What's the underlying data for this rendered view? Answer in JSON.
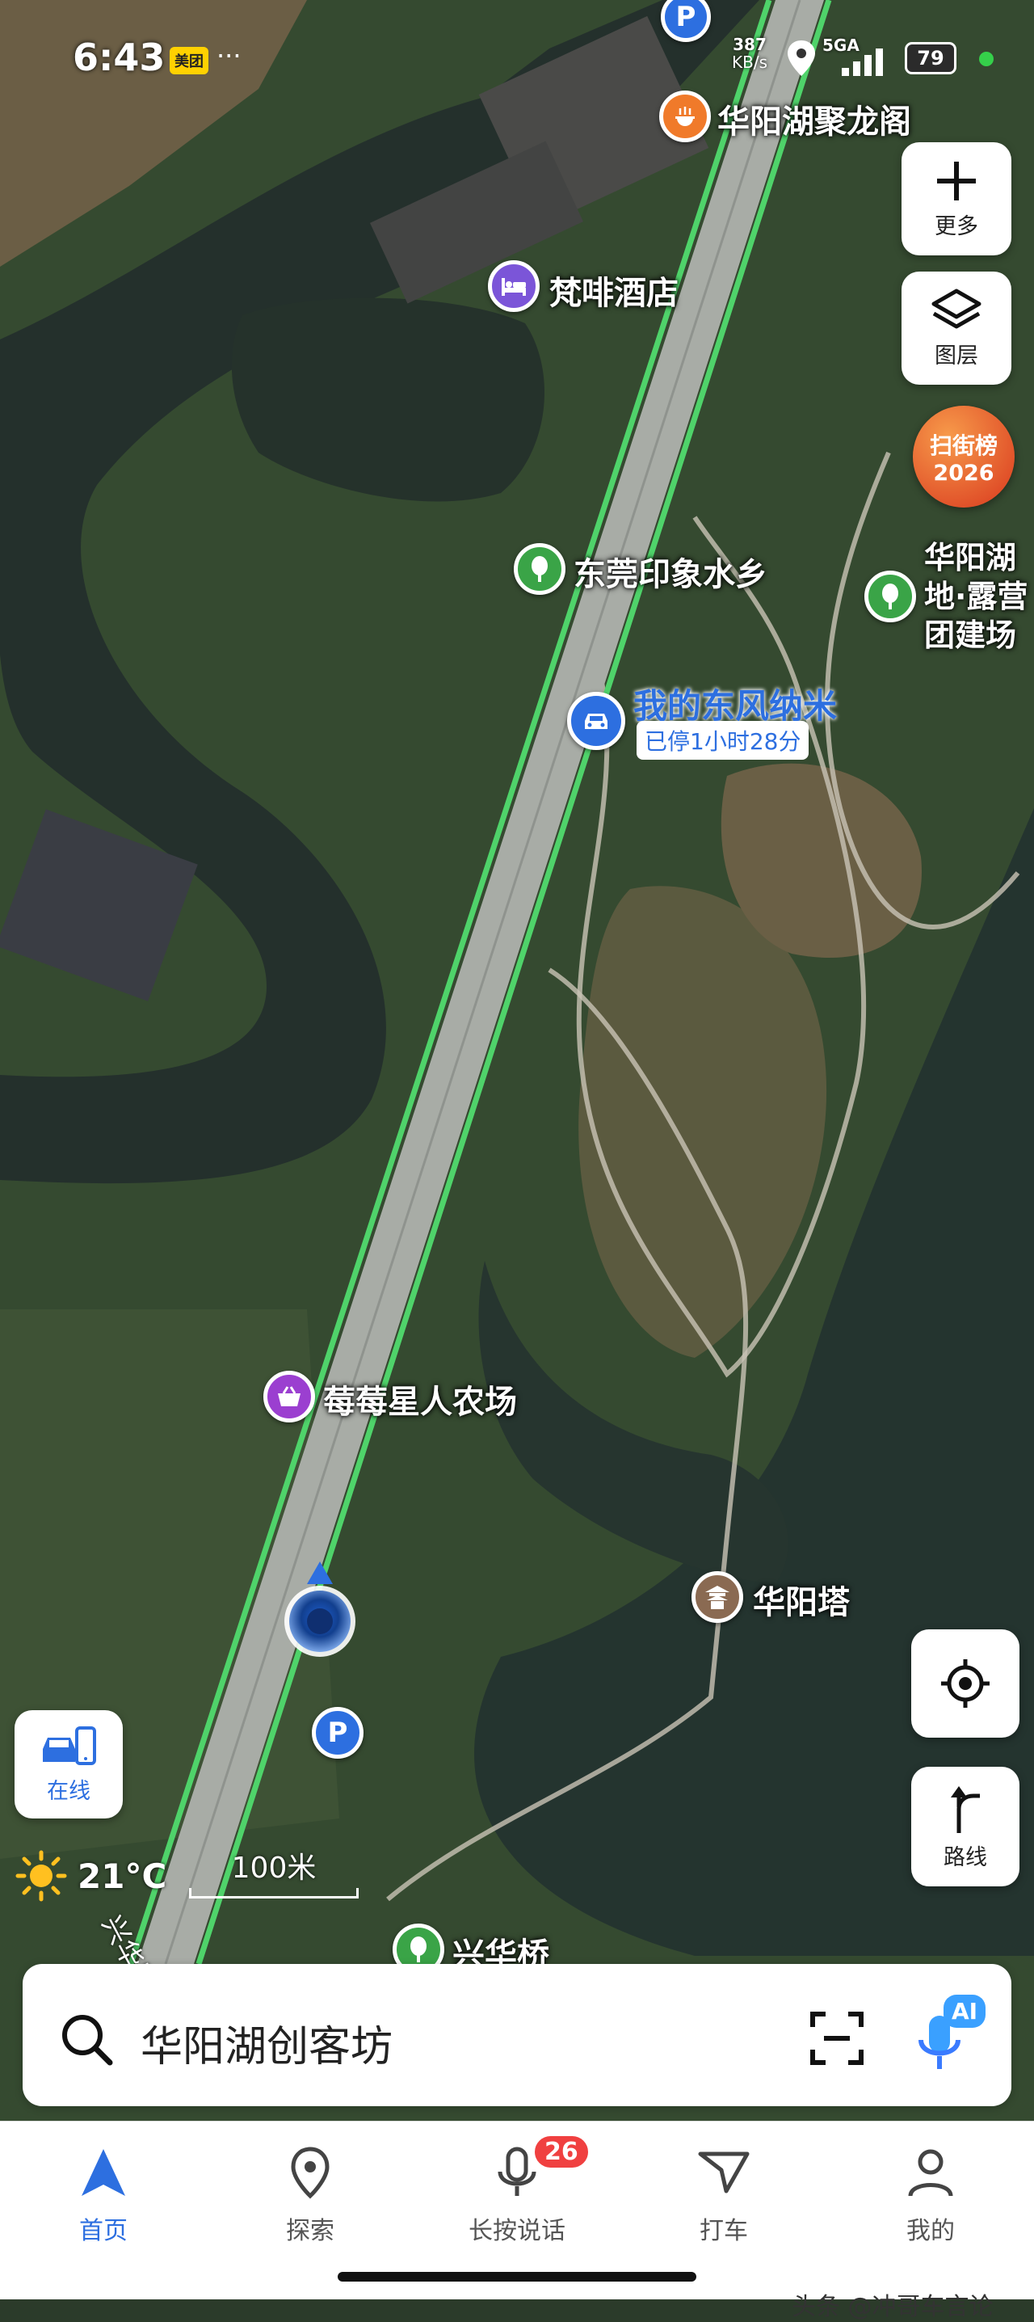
{
  "status": {
    "time": "6:43",
    "app_badge": "美团",
    "more_dots": "···",
    "speed_value": "387",
    "speed_unit": "KB/s",
    "network": "5GA",
    "battery": "79"
  },
  "map": {
    "type": "satellite",
    "pois": [
      {
        "label": "华阳湖聚龙阁",
        "icon": "restaurant-icon",
        "color": "#f07a2a"
      },
      {
        "label": "梵啡酒店",
        "icon": "hotel-icon",
        "color": "#7b55d8"
      },
      {
        "label": "东莞印象水乡",
        "icon": "park-icon",
        "color": "#3aa447"
      },
      {
        "label": "华阳湖",
        "icon": "park-icon",
        "color": "#3aa447"
      },
      {
        "label": "莓莓星人农场",
        "icon": "shopping-basket-icon",
        "color": "#9b3fd0"
      },
      {
        "label": "华阳塔",
        "icon": "pagoda-icon",
        "color": "#8a6a52"
      },
      {
        "label": "兴华桥",
        "icon": "park-icon",
        "color": "#3aa447"
      }
    ],
    "campsite_label_lines": [
      "地·露营",
      "团建场"
    ],
    "parked_car": {
      "name": "我的东风纳米",
      "status": "已停1小时28分",
      "icon": "car-icon",
      "color": "#2d6fe0"
    },
    "road_label": "兴华路",
    "parking_icon": "parking-icon",
    "scale": "100米",
    "weather": {
      "icon": "sun-icon",
      "temp": "21°C"
    }
  },
  "side_buttons": {
    "more": "更多",
    "layers": "图层",
    "ranking_line1": "扫街榜",
    "ranking_line2": "2026",
    "route": "路线",
    "online": "在线"
  },
  "search": {
    "text": "华阳湖创客坊",
    "ai_badge": "AI"
  },
  "nav": {
    "items": [
      "首页",
      "探索",
      "长按说话",
      "打车",
      "我的"
    ],
    "badge": "26",
    "active_color": "#2d6fe0"
  },
  "watermark": "头条 @冲哥车言论"
}
